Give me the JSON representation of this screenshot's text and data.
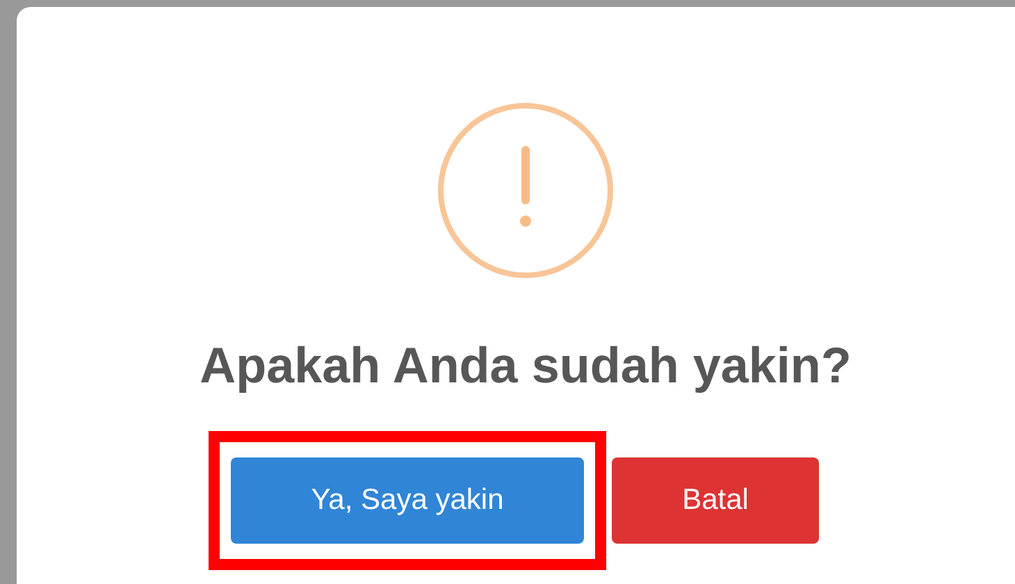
{
  "dialog": {
    "title": "Apakah Anda sudah yakin?",
    "buttons": [
      {
        "label": "Ya, Saya yakin",
        "kind": "confirm",
        "highlighted": true
      },
      {
        "label": "Batal",
        "kind": "cancel",
        "highlighted": false
      }
    ]
  }
}
